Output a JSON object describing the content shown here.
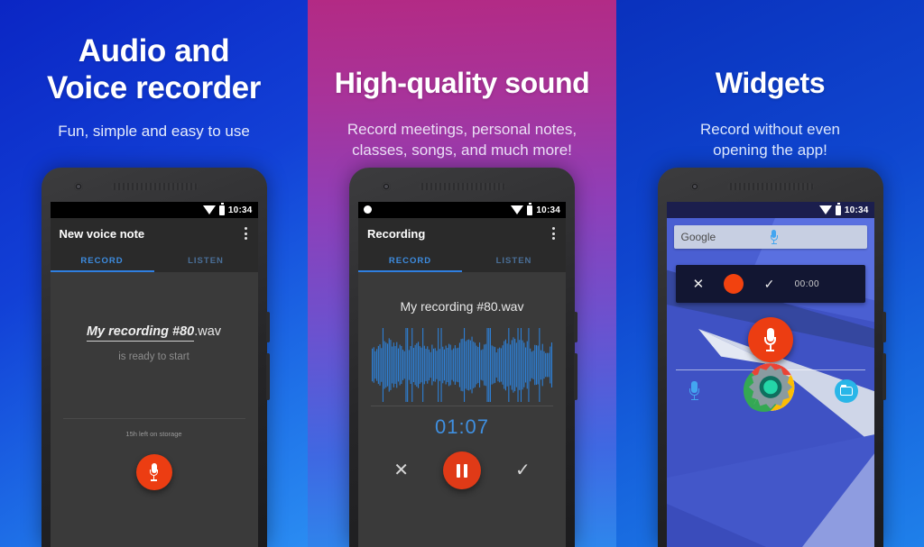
{
  "panels": [
    {
      "id": "panel-audio-voice-recorder",
      "headline_line1": "Audio and",
      "headline_line2": "Voice recorder",
      "subline": "Fun, simple and easy to use",
      "bg_from": "#0b26c4",
      "bg_to": "#2a8cf2",
      "phone": {
        "statusbar": {
          "clock": "10:34",
          "wifi_icon": "wifi-icon",
          "battery_icon": "battery-icon"
        },
        "appbar": {
          "title": "New voice note",
          "overflow_icon": "kebab-menu-icon"
        },
        "tabs": [
          {
            "label": "RECORD",
            "active": true
          },
          {
            "label": "LISTEN",
            "active": false
          }
        ],
        "filename_editable": "My recording #80",
        "filename_extension": ".wav",
        "status_text": "is ready to start",
        "storage_text": "15h left on storage",
        "record_button_icon": "microphone-icon"
      }
    },
    {
      "id": "panel-high-quality-sound",
      "headline_line1": "High-quality sound",
      "headline_line2": "",
      "subline_line1": "Record meetings, personal notes,",
      "subline_line2": "classes, songs, and much more!",
      "bg_from": "#b32a84",
      "bg_to": "#2e86ec",
      "phone": {
        "statusbar": {
          "recording_dot_icon": "recording-dot-icon",
          "clock": "10:34",
          "wifi_icon": "wifi-icon",
          "battery_icon": "battery-icon"
        },
        "appbar": {
          "title": "Recording",
          "overflow_icon": "kebab-menu-icon"
        },
        "tabs": [
          {
            "label": "RECORD",
            "active": true
          },
          {
            "label": "LISTEN",
            "active": false
          }
        ],
        "filename": "My recording #80.wav",
        "waveform_color": "#2e7fd4",
        "timer": "01:07",
        "controls": {
          "cancel_icon": "close-x-icon",
          "pause_icon": "pause-icon",
          "confirm_icon": "checkmark-icon"
        }
      }
    },
    {
      "id": "panel-widgets",
      "headline_line1": "Widgets",
      "headline_line2": "",
      "subline_line1": "Record without even",
      "subline_line2": "opening the app!",
      "bg_from": "#0a31bd",
      "bg_to": "#1f80ea",
      "phone": {
        "statusbar": {
          "clock": "10:34",
          "wifi_icon": "wifi-icon",
          "battery_icon": "battery-icon"
        },
        "search_widget": {
          "label": "Google",
          "voice_icon": "microphone-icon"
        },
        "recorder_widget": {
          "cancel_icon": "close-x-icon",
          "record_icon": "record-dot-icon",
          "confirm_icon": "checkmark-icon",
          "timer": "00:00",
          "mic_icon": "microphone-icon"
        },
        "home_fab_icon": "microphone-icon",
        "dock": [
          {
            "name": "voice-recorder",
            "icon": "microphone-icon"
          },
          {
            "name": "chrome",
            "icon": "chrome-icon"
          },
          {
            "name": "app-drawer",
            "icon": "app-drawer-icon"
          },
          {
            "name": "settings",
            "icon": "gear-icon"
          },
          {
            "name": "files",
            "icon": "folder-icon"
          }
        ]
      }
    }
  ],
  "theme": {
    "accent_orange": "#ec3d12",
    "accent_blue": "#3d8ce0",
    "screen_bg": "#3a3a3a",
    "appbar_bg": "#2a2a2a"
  }
}
